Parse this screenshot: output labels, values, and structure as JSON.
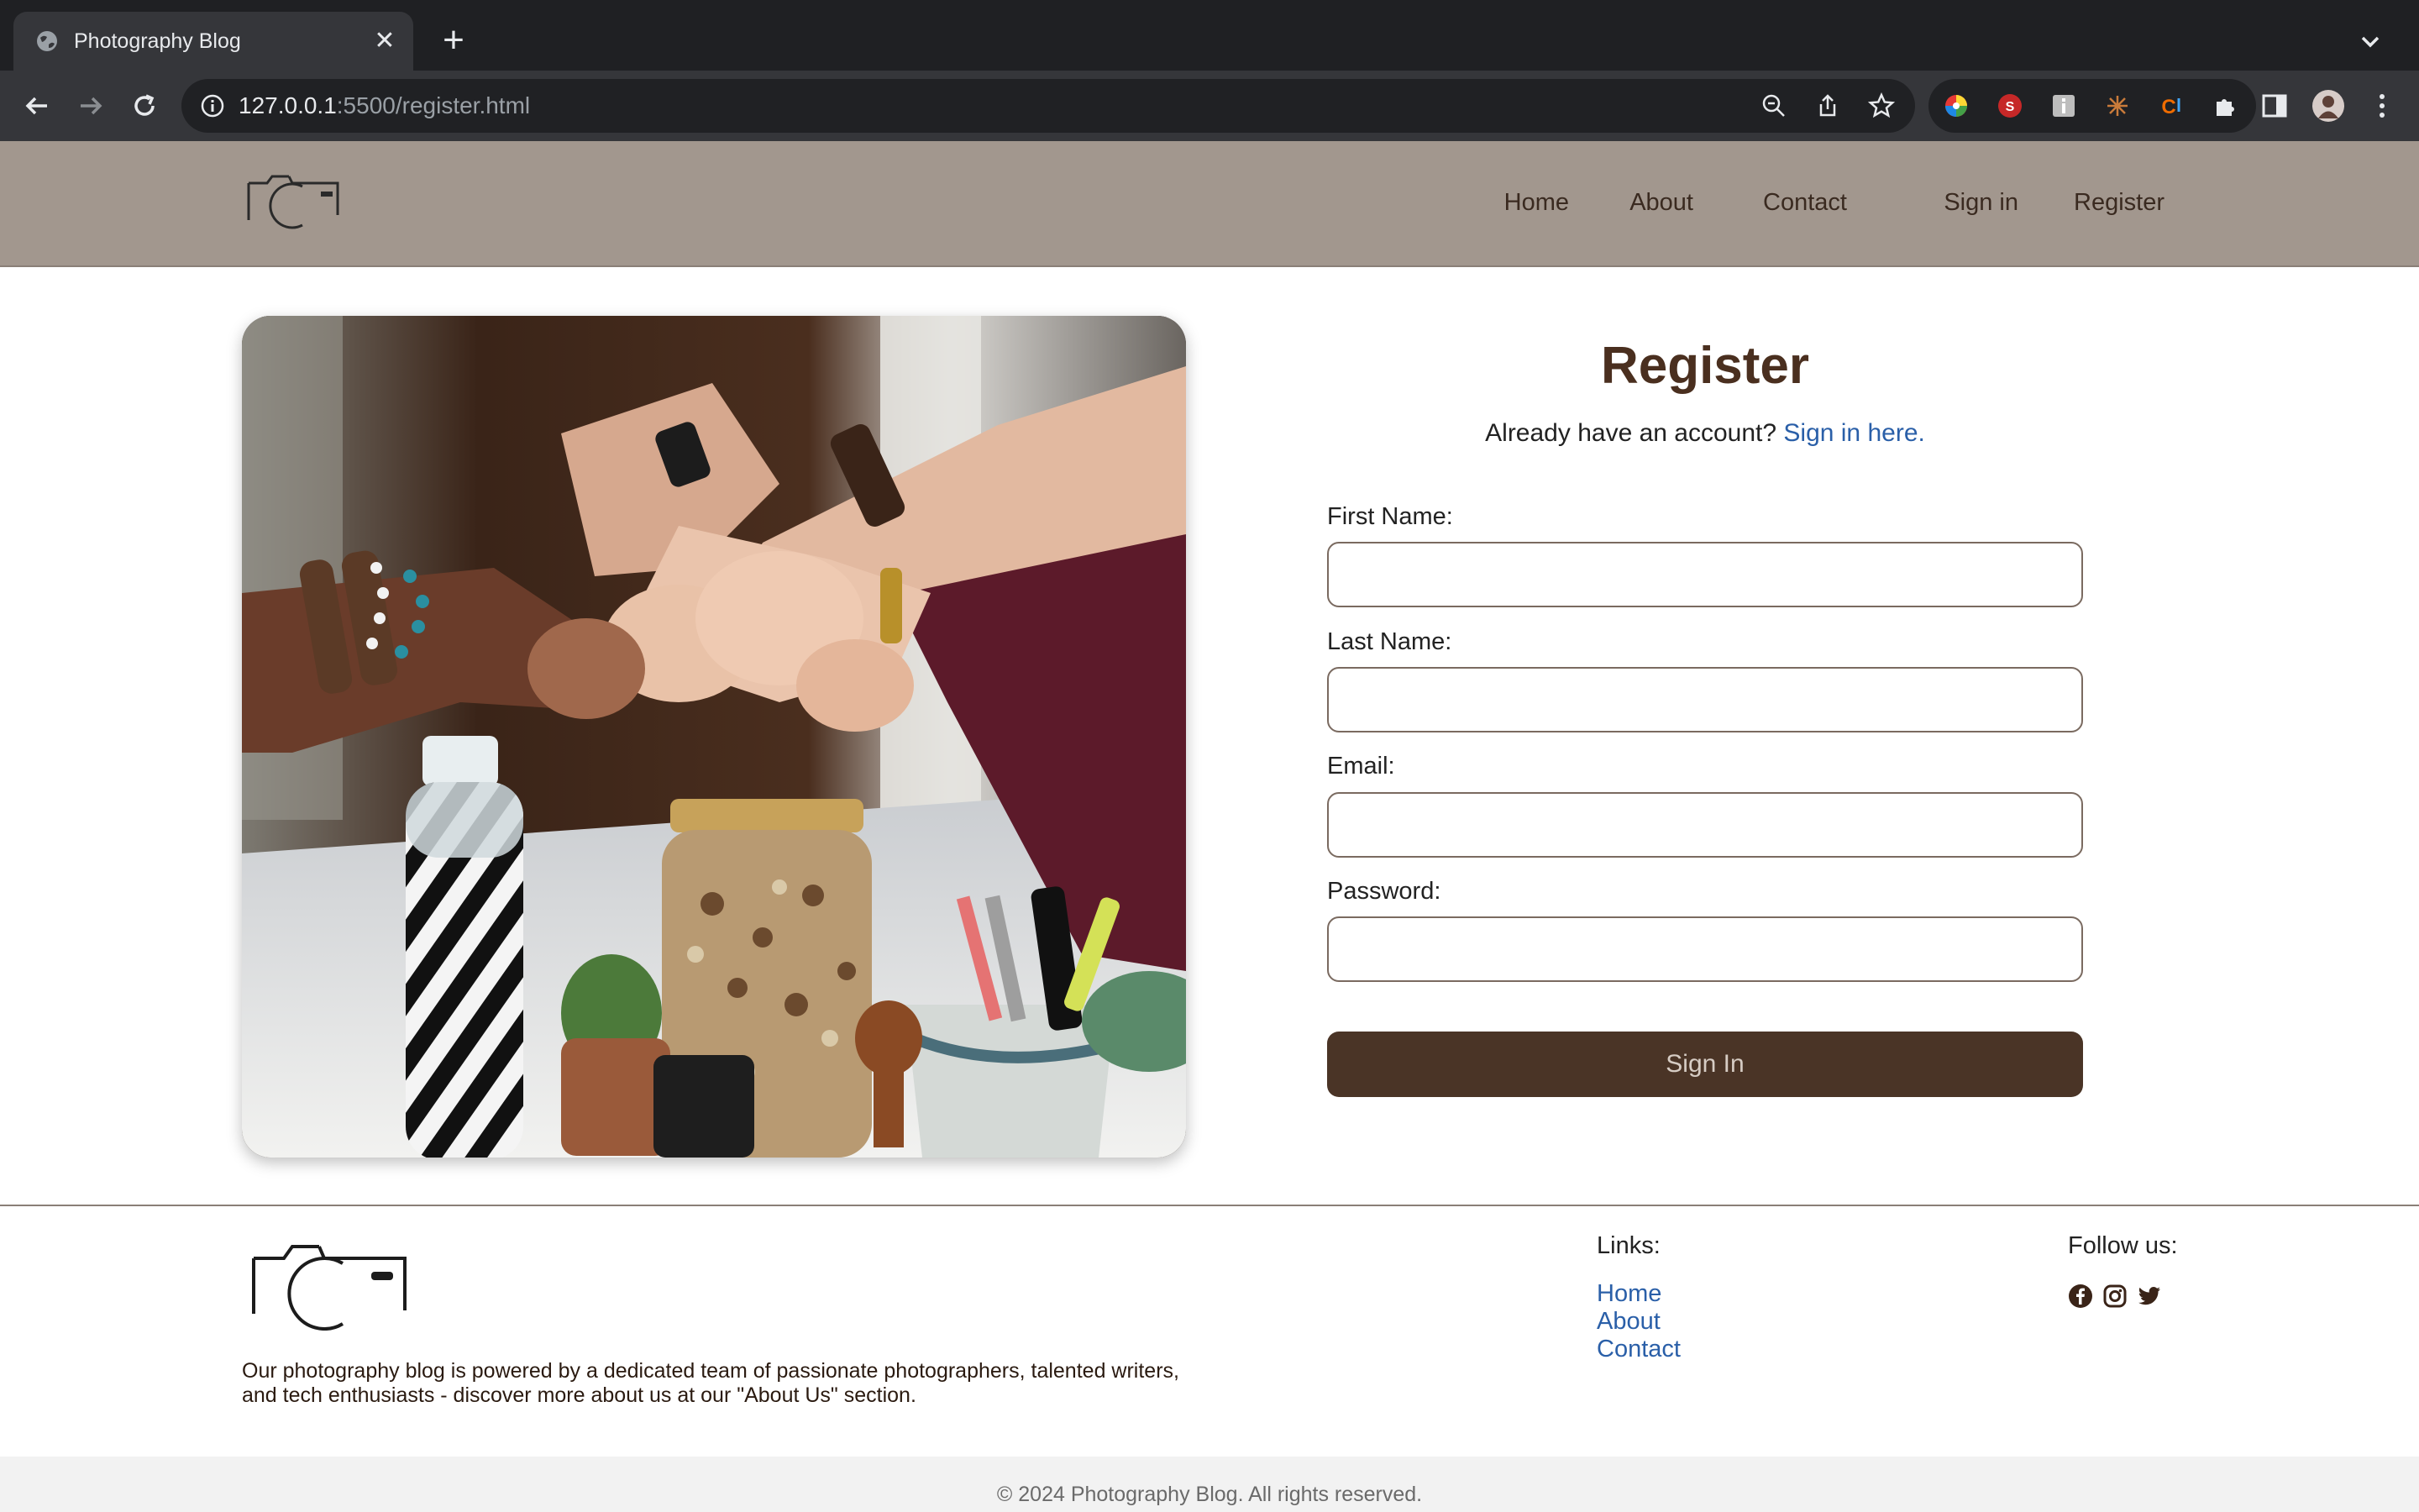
{
  "browser": {
    "tab_title": "Photography Blog",
    "tab_close": "✕",
    "new_tab": "+",
    "url_host": "127.0.0.1",
    "url_rest": ":5500/register.html"
  },
  "header": {
    "nav": [
      "Home",
      "About",
      "Contact",
      "Sign in",
      "Register"
    ]
  },
  "form": {
    "title": "Register",
    "subtitle": "Already have an account?",
    "signin_link": "Sign in here.",
    "fields": [
      {
        "label": "First Name:",
        "value": ""
      },
      {
        "label": "Last Name:",
        "value": ""
      },
      {
        "label": "Email:",
        "value": ""
      },
      {
        "label": "Password:",
        "value": ""
      }
    ],
    "submit_label": "Sign In"
  },
  "footer": {
    "about_line1": "Our photography blog is powered by a dedicated team of passionate photographers, talented writers,",
    "about_line2": "and tech enthusiasts - discover more about us at our \"About Us\" section.",
    "links_heading": "Links:",
    "links": [
      "Home",
      "About",
      "Contact"
    ],
    "follow_heading": "Follow us:",
    "social_icons": [
      "facebook-icon",
      "instagram-icon",
      "twitter-icon"
    ],
    "copyright": "© 2024 Photography Blog. All rights reserved."
  },
  "colors": {
    "header_bg": "#a2978e",
    "brand_brown": "#4a3426",
    "link_blue": "#2a5fa8"
  }
}
